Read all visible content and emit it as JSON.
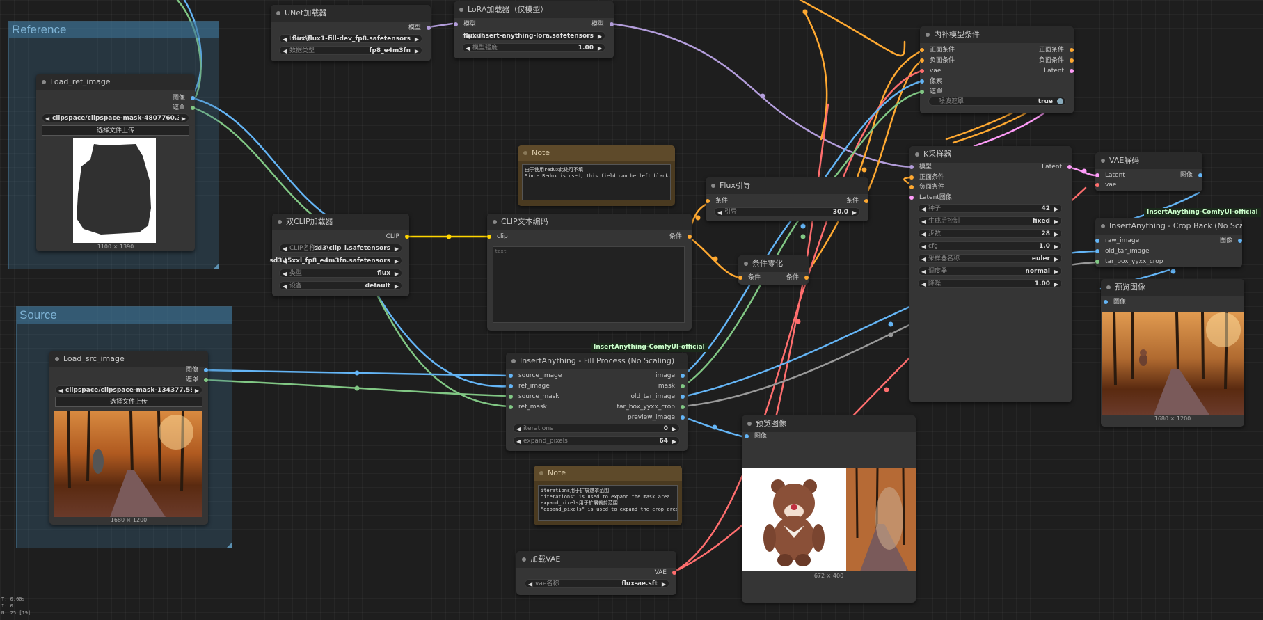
{
  "colors": {
    "image": "#64b5f6",
    "mask": "#81c784",
    "model": "#b39ddb",
    "clip": "#ffd500",
    "conditioning": "#ffa931",
    "vae": "#ff6e6e",
    "latent": "#ff9cf9"
  },
  "groups": {
    "reference": "Reference",
    "source": "Source"
  },
  "load_ref": {
    "title": "Load_ref_image",
    "out_image": "图像",
    "out_mask": "遮罩",
    "file": "clipspace/clipspace-mask-4807760.3000 ...",
    "upload": "选择文件上传",
    "size": "1100 × 1390"
  },
  "load_src": {
    "title": "Load_src_image",
    "out_image": "图像",
    "out_mask": "遮罩",
    "file": "clipspace/clipspace-mask-134377.59999 ...",
    "upload": "选择文件上传",
    "size": "1680 × 1200"
  },
  "unet": {
    "title": "UNet加载器",
    "out_model": "模型",
    "w1_label": "UNet名...",
    "w1_value": "flux\\flux1-fill-dev_fp8.safetensors",
    "w2_label": "数据类型",
    "w2_value": "fp8_e4m3fn"
  },
  "lora": {
    "title": "LoRA加载器（仅模型）",
    "in_model": "模型",
    "out_model": "模型",
    "w1_label": "LoR...",
    "w1_value": "flux\\insert-anything-lora.safetensors",
    "w2_label": "模型强度",
    "w2_value": "1.00"
  },
  "dualclip": {
    "title": "双CLIP加载器",
    "out_clip": "CLIP",
    "w1_label": "CLIP名称1",
    "w1_value": "sd3\\clip_l.safetensors",
    "w2_label": "",
    "w2_value": "sd3\\t5xxl_fp8_e4m3fn.safetensors",
    "w3_label": "类型",
    "w3_value": "flux",
    "w4_label": "设备",
    "w4_value": "default"
  },
  "clipenc": {
    "title": "CLIP文本编码",
    "in_clip": "clip",
    "out_cond": "条件",
    "placeholder": "text"
  },
  "note1": {
    "title": "Note",
    "text": "由于使用redux此处可不填\nSince Redux is used, this field can be left blank."
  },
  "fluxguide": {
    "title": "Flux引导",
    "in_cond": "条件",
    "out_cond": "条件",
    "w_label": "引导",
    "w_value": "30.0"
  },
  "condzero": {
    "title": "条件零化",
    "in_cond": "条件",
    "out_cond": "条件"
  },
  "inpaint": {
    "title": "内补模型条件",
    "in_pos": "正面条件",
    "in_neg": "负面条件",
    "in_vae": "vae",
    "in_pix": "像素",
    "in_mask": "遮罩",
    "out_pos": "正面条件",
    "out_neg": "负面条件",
    "out_latent": "Latent",
    "w_label": "噪波遮罩",
    "w_value": "true"
  },
  "ksampler": {
    "title": "K采样器",
    "in_model": "模型",
    "in_pos": "正面条件",
    "in_neg": "负面条件",
    "in_latent": "Latent图像",
    "out_latent": "Latent",
    "widgets": [
      {
        "label": "种子",
        "value": "42"
      },
      {
        "label": "生成后控制",
        "value": "fixed"
      },
      {
        "label": "步数",
        "value": "28"
      },
      {
        "label": "cfg",
        "value": "1.0"
      },
      {
        "label": "采样器名称",
        "value": "euler"
      },
      {
        "label": "调度器",
        "value": "normal"
      },
      {
        "label": "降噪",
        "value": "1.00"
      }
    ]
  },
  "vaedecode": {
    "title": "VAE解码",
    "in_latent": "Latent",
    "in_vae": "vae",
    "out_image": "图像"
  },
  "cropback": {
    "tag": "InsertAnything-ComfyUI-official",
    "title": "InsertAnything - Crop Back (No Scaling)",
    "in_raw": "raw_image",
    "in_old": "old_tar_image",
    "in_box": "tar_box_yyxx_crop",
    "out_image": "图像"
  },
  "preview_right": {
    "title": "预览图像",
    "in_image": "图像",
    "size": "1680 × 1200"
  },
  "fillproc": {
    "tag": "InsertAnything-ComfyUI-official",
    "title": "InsertAnything - Fill Process (No Scaling)",
    "in1": "source_image",
    "in2": "ref_image",
    "in3": "source_mask",
    "in4": "ref_mask",
    "out1": "image",
    "out2": "mask",
    "out3": "old_tar_image",
    "out4": "tar_box_yyxx_crop",
    "out5": "preview_image",
    "w1_label": "iterations",
    "w1_value": "0",
    "w2_label": "expand_pixels",
    "w2_value": "64"
  },
  "note2": {
    "title": "Note",
    "text": "iterations用于扩展遮罩范围\n\"iterations\" is used to expand the mask area.\nexpand_pixels用于扩展裁剪范围\n\"expand_pixels\" is used to expand the crop area."
  },
  "preview_mid": {
    "title": "预览图像",
    "in_image": "图像",
    "size": "672 × 400"
  },
  "vaeload": {
    "title": "加载VAE",
    "out_vae": "VAE",
    "w_label": "vae名称",
    "w_value": "flux-ae.sft"
  },
  "stats": {
    "l1": "T: 0.00s",
    "l2": "I: 0",
    "l3": "N: 25 [19]"
  }
}
